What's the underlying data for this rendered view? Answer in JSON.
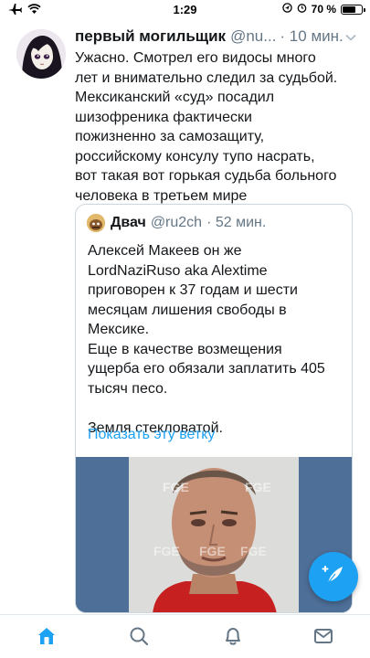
{
  "status_bar": {
    "time": "1:29",
    "battery_percent_label": "70 %",
    "battery_level": 0.7,
    "icons": [
      "airplane-icon",
      "wifi-icon",
      "location-icon",
      "alarm-icon",
      "battery-icon"
    ]
  },
  "tweet": {
    "author_name": "первый могильщик",
    "author_handle": "@nu...",
    "time": "· 10 мин.",
    "text": "Ужасно. Смотрел его видосы много\nлет и внимательно следил за судьбой.\nМексиканский «суд» посадил\nшизофреника фактически\nпожизненно за самозащиту,\nроссийскому консулу тупо насрать,\nвот такая вот горькая судьба больного\nчеловека в третьем мире"
  },
  "quoted_tweet": {
    "author_name": "Двач",
    "author_handle": "@ru2ch",
    "time": "· 52 мин.",
    "text": "Алексей Макеев он же\nLordNaziRuso aka Alextime\nприговорен к 37 годам и шести\nмесяцам лишения свободы в\nМексике.\nЕще в качестве возмещения\nущерба его обязали заплатить 405\nтысяч песо.\n\nЗемля стекловатой.",
    "thread_link": "Показать эту ветку",
    "image_watermark": "FGE"
  },
  "tab_bar": {
    "tabs": [
      "home-icon",
      "search-icon",
      "notifications-icon",
      "messages-icon"
    ],
    "active": "home-icon"
  },
  "colors": {
    "accent": "#1da1f2",
    "text": "#14171a",
    "secondary_text": "#657786",
    "border": "#ccd6dd"
  }
}
